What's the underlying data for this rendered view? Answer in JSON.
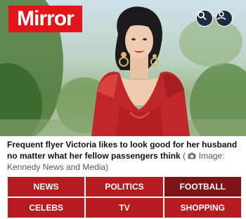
{
  "header": {
    "logo_text": "Mirror",
    "brand_color": "#e4141b",
    "search_icon": "search-icon",
    "account_icon": "user-icon"
  },
  "hero": {
    "description_icon": "photo"
  },
  "caption": {
    "text": "Frequent flyer Victoria likes to look good for her husband no matter what her fellow passengers think",
    "camera_icon": "camera-icon",
    "credit": "Image: Kennedy News and Media)"
  },
  "nav": {
    "items": [
      {
        "label": "NEWS"
      },
      {
        "label": "POLITICS"
      },
      {
        "label": "FOOTBALL"
      },
      {
        "label": "CELEBS"
      },
      {
        "label": "TV"
      },
      {
        "label": "SHOPPING"
      }
    ],
    "color": "#b61b1f",
    "active_color": "#7e1418"
  }
}
